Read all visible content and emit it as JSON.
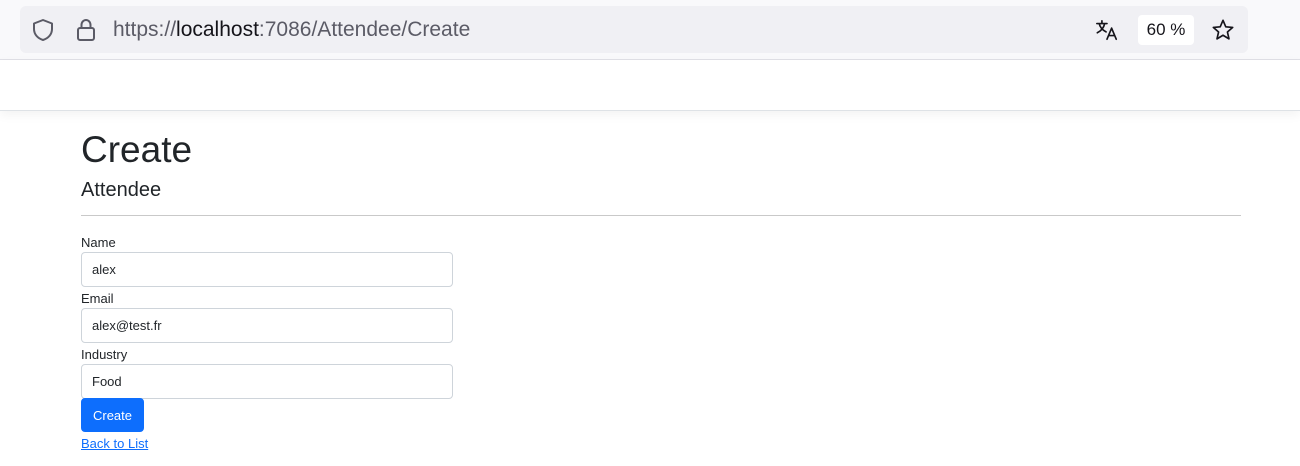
{
  "browser": {
    "url_scheme": "https://",
    "url_host": "localhost",
    "url_rest": ":7086/Attendee/Create",
    "zoom": "60 %",
    "icons": {
      "shield": "shield-icon",
      "lock": "lock-icon",
      "translate": "translate-icon",
      "star": "star-icon"
    }
  },
  "page": {
    "title": "Create",
    "subtitle": "Attendee",
    "form": {
      "name_label": "Name",
      "name_value": "alex",
      "email_label": "Email",
      "email_value": "alex@test.fr",
      "industry_label": "Industry",
      "industry_value": "Food",
      "submit_label": "Create"
    },
    "back_link": "Back to List"
  },
  "colors": {
    "primary": "#0d6efd",
    "text": "#212529"
  }
}
